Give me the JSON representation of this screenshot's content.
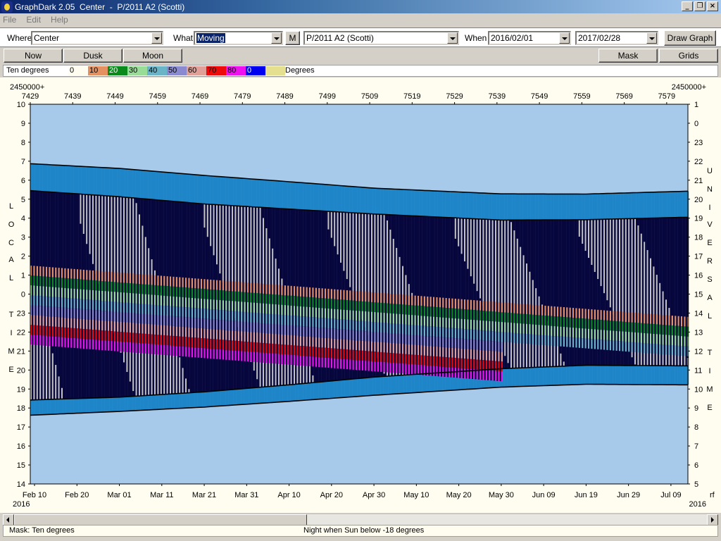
{
  "window": {
    "title": "GraphDark 2.05  Center  -  P/2011 A2 (Scotti)"
  },
  "menu": [
    "File",
    "Edit",
    "Help"
  ],
  "toolbar": {
    "where_label": "Where",
    "where_value": "Center",
    "what_label": "What",
    "what_value": "Moving",
    "m_button": "M",
    "object_value": "P/2011 A2 (Scotti)",
    "when_label": "When",
    "from_date": "2016/02/01",
    "to_date": "2017/02/28",
    "draw_button": "Draw Graph"
  },
  "toolbar2": {
    "now": "Now",
    "dusk": "Dusk",
    "moon": "Moon",
    "mask": "Mask",
    "grids": "Grids"
  },
  "legend": {
    "title": "Ten degrees",
    "unit": "Degrees",
    "swatches": [
      {
        "label": "0",
        "color": "#fffdf0"
      },
      {
        "label": "10",
        "color": "#e49060"
      },
      {
        "label": "20",
        "color": "#0a8a1a"
      },
      {
        "label": "30",
        "color": "#98dc98"
      },
      {
        "label": "40",
        "color": "#6ab4c8"
      },
      {
        "label": "50",
        "color": "#8a8ad0"
      },
      {
        "label": "60",
        "color": "#e0a098"
      },
      {
        "label": "70",
        "color": "#ee0a0a"
      },
      {
        "label": "80",
        "color": "#ee10ee"
      },
      {
        "label": "0",
        "color": "#0000f0"
      },
      {
        "label": "",
        "color": "#e4e090"
      }
    ]
  },
  "colors": {
    "sky": "#a7c9ea",
    "night": "#07073e",
    "twilight": "#1e86c8",
    "moon": "#c2c2c2",
    "alt10": "#e49060",
    "alt20": "#0a8a1a",
    "alt30": "#98dc98",
    "alt40": "#6ab4c8",
    "alt50": "#8a8ad0",
    "alt60": "#e0a098",
    "alt70": "#ee0a0a",
    "alt80": "#ee10ee"
  },
  "chart_data": {
    "type": "heatmap",
    "top_prefix": "2450000+",
    "jd_ticks": [
      "7429",
      "7439",
      "7449",
      "7459",
      "7469",
      "7479",
      "7489",
      "7499",
      "7509",
      "7519",
      "7529",
      "7539",
      "7549",
      "7559",
      "7569",
      "7579"
    ],
    "date_ticks": [
      "Feb 10",
      "Feb 20",
      "Mar 01",
      "Mar 11",
      "Mar 21",
      "Mar 31",
      "Apr 10",
      "Apr 20",
      "Apr 30",
      "May 10",
      "May 20",
      "May 30",
      "Jun 09",
      "Jun 19",
      "Jun 29",
      "Jul 09"
    ],
    "year_left": "2016",
    "year_right": "2016",
    "right_corner_label": "rf",
    "left_hours": [
      "10",
      "9",
      "8",
      "7",
      "6",
      "5",
      "4",
      "3",
      "2",
      "1",
      "0",
      "23",
      "22",
      "21",
      "20",
      "19",
      "18",
      "17",
      "16",
      "15",
      "14"
    ],
    "right_hours": [
      "1",
      "0",
      "23",
      "22",
      "21",
      "20",
      "19",
      "18",
      "17",
      "16",
      "15",
      "14",
      "13",
      "12",
      "11",
      "10",
      "9",
      "8",
      "7",
      "6",
      "5"
    ],
    "left_axis_text": "LOCAL TIME",
    "right_axis_text": "UNIVERSAL TIME",
    "x_range_jd": [
      2457429,
      2457584
    ],
    "y_range_local_hours": [
      14,
      34
    ],
    "curves": {
      "evening_civil_twilight": [
        [
          2457429,
          30.87
        ],
        [
          2457450,
          30.62
        ],
        [
          2457470,
          30.25
        ],
        [
          2457490,
          29.92
        ],
        [
          2457510,
          29.58
        ],
        [
          2457540,
          29.28
        ],
        [
          2457560,
          29.27
        ],
        [
          2457584,
          29.42
        ]
      ],
      "evening_astronomical_twilight": [
        [
          2457429,
          29.45
        ],
        [
          2457450,
          29.13
        ],
        [
          2457470,
          28.75
        ],
        [
          2457490,
          28.48
        ],
        [
          2457510,
          28.22
        ],
        [
          2457540,
          27.9
        ],
        [
          2457560,
          27.92
        ],
        [
          2457584,
          28.05
        ]
      ],
      "morning_astronomical_twilight": [
        [
          2457429,
          18.42
        ],
        [
          2457450,
          18.57
        ],
        [
          2457470,
          18.85
        ],
        [
          2457490,
          19.22
        ],
        [
          2457510,
          19.63
        ],
        [
          2457540,
          20.07
        ],
        [
          2457560,
          20.25
        ],
        [
          2457584,
          20.22
        ]
      ],
      "morning_civil_twilight": [
        [
          2457429,
          17.62
        ],
        [
          2457450,
          17.82
        ],
        [
          2457470,
          18.05
        ],
        [
          2457490,
          18.35
        ],
        [
          2457510,
          18.67
        ],
        [
          2457540,
          19.1
        ],
        [
          2457560,
          19.25
        ],
        [
          2457584,
          19.22
        ]
      ]
    },
    "moon_new_moons_jd": [
      2457438.5,
      2457468,
      2457497.5,
      2457527,
      2457556.5
    ],
    "comet_set_local_hours": [
      [
        2457429,
        25.5
      ],
      [
        2457584,
        22.8
      ]
    ]
  },
  "status": {
    "mask": "Mask:  Ten degrees",
    "night": "Night when Sun below -18 degrees"
  }
}
